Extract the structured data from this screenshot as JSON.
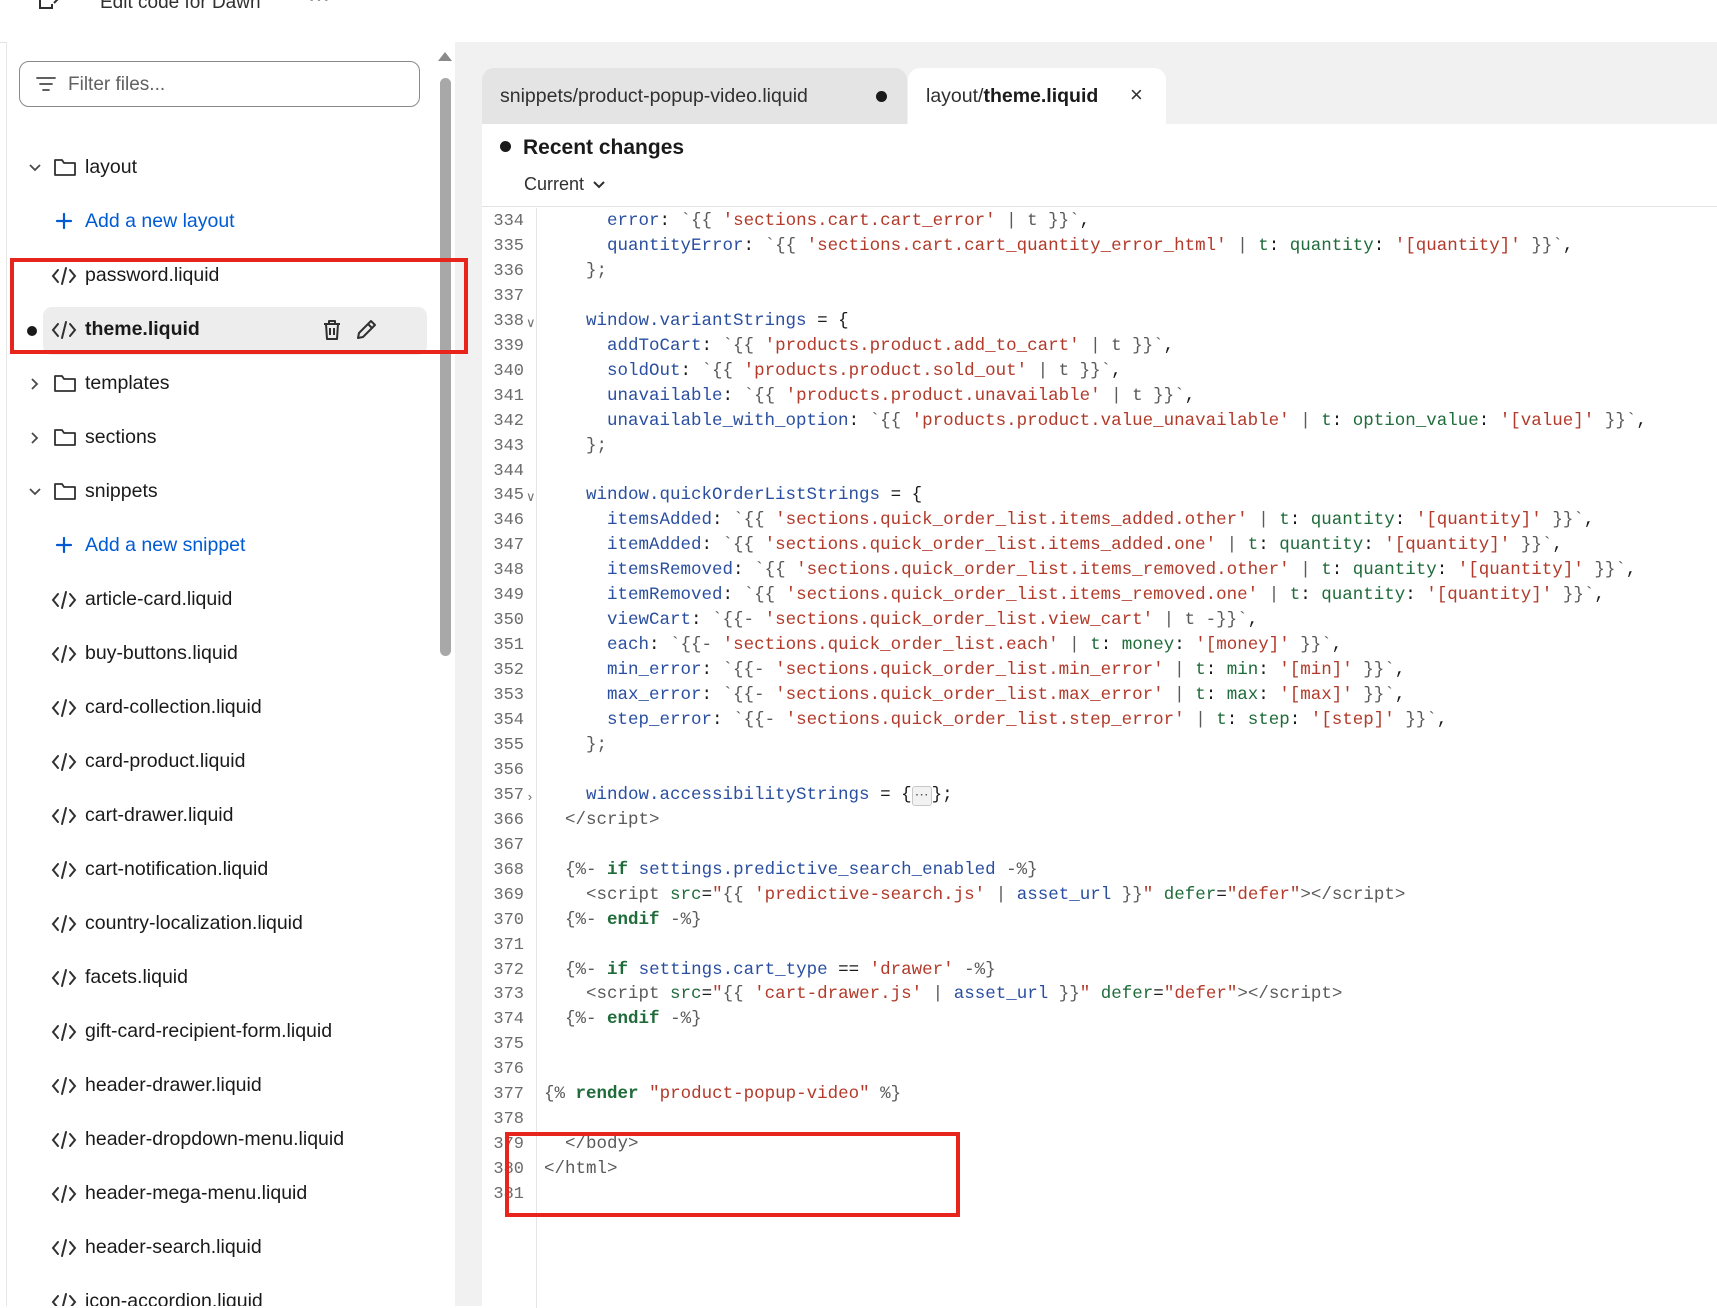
{
  "header": {
    "title": "Edit code for Dawn",
    "more_label": "⋯"
  },
  "sidebar": {
    "filter_placeholder": "Filter files...",
    "items": [
      {
        "type": "folder",
        "label": "layout",
        "expanded": true
      },
      {
        "type": "add",
        "label": "Add a new layout"
      },
      {
        "type": "file",
        "label": "password.liquid"
      },
      {
        "type": "file",
        "label": "theme.liquid",
        "selected": true,
        "modified": true
      },
      {
        "type": "folder",
        "label": "templates",
        "expanded": false
      },
      {
        "type": "folder",
        "label": "sections",
        "expanded": false
      },
      {
        "type": "folder",
        "label": "snippets",
        "expanded": true
      },
      {
        "type": "add",
        "label": "Add a new snippet"
      },
      {
        "type": "file",
        "label": "article-card.liquid"
      },
      {
        "type": "file",
        "label": "buy-buttons.liquid"
      },
      {
        "type": "file",
        "label": "card-collection.liquid"
      },
      {
        "type": "file",
        "label": "card-product.liquid"
      },
      {
        "type": "file",
        "label": "cart-drawer.liquid"
      },
      {
        "type": "file",
        "label": "cart-notification.liquid"
      },
      {
        "type": "file",
        "label": "country-localization.liquid"
      },
      {
        "type": "file",
        "label": "facets.liquid"
      },
      {
        "type": "file",
        "label": "gift-card-recipient-form.liquid"
      },
      {
        "type": "file",
        "label": "header-drawer.liquid"
      },
      {
        "type": "file",
        "label": "header-dropdown-menu.liquid"
      },
      {
        "type": "file",
        "label": "header-mega-menu.liquid"
      },
      {
        "type": "file",
        "label": "header-search.liquid"
      },
      {
        "type": "file",
        "label": "icon-accordion.liquid"
      }
    ]
  },
  "tabs": [
    {
      "label": "snippets/product-popup-video.liquid",
      "unsaved": true,
      "active": false
    },
    {
      "label_prefix": "layout/",
      "label_bold": "theme.liquid",
      "active": true
    }
  ],
  "editor": {
    "recent_changes": "Recent changes",
    "version_select": "Current",
    "accent_highlight": "#e8251d",
    "lines": [
      {
        "n": "334",
        "html": "      <span class='p'>error</span>: <span class='d'>`{{</span> <span class='s'>'sections.cart.cart_error'</span> <span class='d'>| t }}`</span>,"
      },
      {
        "n": "335",
        "html": "      <span class='p'>quantityError</span>: <span class='d'>`{{</span> <span class='s'>'sections.cart.cart_quantity_error_html'</span> <span class='d'>|</span> <span class='k'>t</span>: <span class='k'>quantity</span>: <span class='s'>'[quantity]'</span> <span class='d'>}}`</span>,"
      },
      {
        "n": "336",
        "html": "    <span class='d'>};</span>"
      },
      {
        "n": "337",
        "html": ""
      },
      {
        "n": "338",
        "fold": "v",
        "html": "    <span class='p'>window.variantStrings</span> = {"
      },
      {
        "n": "339",
        "html": "      <span class='p'>addToCart</span>: <span class='d'>`{{</span> <span class='s'>'products.product.add_to_cart'</span> <span class='d'>| t }}`</span>,"
      },
      {
        "n": "340",
        "html": "      <span class='p'>soldOut</span>: <span class='d'>`{{</span> <span class='s'>'products.product.sold_out'</span> <span class='d'>| t }}`</span>,"
      },
      {
        "n": "341",
        "html": "      <span class='p'>unavailable</span>: <span class='d'>`{{</span> <span class='s'>'products.product.unavailable'</span> <span class='d'>| t }}`</span>,"
      },
      {
        "n": "342",
        "html": "      <span class='p'>unavailable_with_option</span>: <span class='d'>`{{</span> <span class='s'>'products.product.value_unavailable'</span> <span class='d'>|</span> <span class='k'>t</span>: <span class='k'>option_value</span>: <span class='s'>'[value]'</span> <span class='d'>}}`</span>,"
      },
      {
        "n": "343",
        "html": "    <span class='d'>};</span>"
      },
      {
        "n": "344",
        "html": ""
      },
      {
        "n": "345",
        "fold": "v",
        "html": "    <span class='p'>window.quickOrderListStrings</span> = {"
      },
      {
        "n": "346",
        "html": "      <span class='p'>itemsAdded</span>: <span class='d'>`{{</span> <span class='s'>'sections.quick_order_list.items_added.other'</span> <span class='d'>|</span> <span class='k'>t</span>: <span class='k'>quantity</span>: <span class='s'>'[quantity]'</span> <span class='d'>}}`</span>,"
      },
      {
        "n": "347",
        "html": "      <span class='p'>itemAdded</span>: <span class='d'>`{{</span> <span class='s'>'sections.quick_order_list.items_added.one'</span> <span class='d'>|</span> <span class='k'>t</span>: <span class='k'>quantity</span>: <span class='s'>'[quantity]'</span> <span class='d'>}}`</span>,"
      },
      {
        "n": "348",
        "html": "      <span class='p'>itemsRemoved</span>: <span class='d'>`{{</span> <span class='s'>'sections.quick_order_list.items_removed.other'</span> <span class='d'>|</span> <span class='k'>t</span>: <span class='k'>quantity</span>: <span class='s'>'[quantity]'</span> <span class='d'>}}`</span>,"
      },
      {
        "n": "349",
        "html": "      <span class='p'>itemRemoved</span>: <span class='d'>`{{</span> <span class='s'>'sections.quick_order_list.items_removed.one'</span> <span class='d'>|</span> <span class='k'>t</span>: <span class='k'>quantity</span>: <span class='s'>'[quantity]'</span> <span class='d'>}}`</span>,"
      },
      {
        "n": "350",
        "html": "      <span class='p'>viewCart</span>: <span class='d'>`{{-</span> <span class='s'>'sections.quick_order_list.view_cart'</span> <span class='d'>| t -}}`</span>,"
      },
      {
        "n": "351",
        "html": "      <span class='p'>each</span>: <span class='d'>`{{-</span> <span class='s'>'sections.quick_order_list.each'</span> <span class='d'>|</span> <span class='k'>t</span>: <span class='k'>money</span>: <span class='s'>'[money]'</span> <span class='d'>}}`</span>,"
      },
      {
        "n": "352",
        "html": "      <span class='p'>min_error</span>: <span class='d'>`{{-</span> <span class='s'>'sections.quick_order_list.min_error'</span> <span class='d'>|</span> <span class='k'>t</span>: <span class='k'>min</span>: <span class='s'>'[min]'</span> <span class='d'>}}`</span>,"
      },
      {
        "n": "353",
        "html": "      <span class='p'>max_error</span>: <span class='d'>`{{-</span> <span class='s'>'sections.quick_order_list.max_error'</span> <span class='d'>|</span> <span class='k'>t</span>: <span class='k'>max</span>: <span class='s'>'[max]'</span> <span class='d'>}}`</span>,"
      },
      {
        "n": "354",
        "html": "      <span class='p'>step_error</span>: <span class='d'>`{{-</span> <span class='s'>'sections.quick_order_list.step_error'</span> <span class='d'>|</span> <span class='k'>t</span>: <span class='k'>step</span>: <span class='s'>'[step]'</span> <span class='d'>}}`</span>,"
      },
      {
        "n": "355",
        "html": "    <span class='d'>};</span>"
      },
      {
        "n": "356",
        "html": ""
      },
      {
        "n": "357",
        "fold": ">",
        "html": "    <span class='p'>window.accessibilityStrings</span> = {<span class='ell'>⋯</span>};"
      },
      {
        "n": "366",
        "html": "  <span class='d'>&lt;/script&gt;</span>"
      },
      {
        "n": "367",
        "html": ""
      },
      {
        "n": "368",
        "html": "  <span class='d'>{%-</span> <span class='kb'>if</span> <span class='p'>settings.predictive_search_enabled</span> <span class='d'>-%}</span>"
      },
      {
        "n": "369",
        "html": "    <span class='d'>&lt;script</span> <span class='k'>src</span>=<span class='s'>\"</span><span class='d'>{{</span> <span class='s'>'predictive-search.js'</span> <span class='d'>|</span> <span class='p'>asset_url</span> <span class='d'>}}</span><span class='s'>\"</span> <span class='k'>defer</span>=<span class='s'>\"defer\"</span><span class='d'>&gt;&lt;/script&gt;</span>"
      },
      {
        "n": "370",
        "html": "  <span class='d'>{%-</span> <span class='kb'>endif</span> <span class='d'>-%}</span>"
      },
      {
        "n": "371",
        "html": ""
      },
      {
        "n": "372",
        "html": "  <span class='d'>{%-</span> <span class='kb'>if</span> <span class='p'>settings.cart_type</span> == <span class='s'>'drawer'</span> <span class='d'>-%}</span>"
      },
      {
        "n": "373",
        "html": "    <span class='d'>&lt;script</span> <span class='k'>src</span>=<span class='s'>\"</span><span class='d'>{{</span> <span class='s'>'cart-drawer.js'</span> <span class='d'>|</span> <span class='p'>asset_url</span> <span class='d'>}}</span><span class='s'>\"</span> <span class='k'>defer</span>=<span class='s'>\"defer\"</span><span class='d'>&gt;&lt;/script&gt;</span>"
      },
      {
        "n": "374",
        "html": "  <span class='d'>{%-</span> <span class='kb'>endif</span> <span class='d'>-%}</span>"
      },
      {
        "n": "375",
        "html": ""
      },
      {
        "n": "376",
        "html": ""
      },
      {
        "n": "377",
        "html": "<span class='d'>{%</span> <span class='kb'>render</span> <span class='s'>\"product-popup-video\"</span> <span class='d'>%}</span>"
      },
      {
        "n": "378",
        "html": ""
      },
      {
        "n": "379",
        "html": "  <span class='d'>&lt;/body&gt;</span>"
      },
      {
        "n": "380",
        "html": "<span class='d'>&lt;/html&gt;</span>"
      },
      {
        "n": "381",
        "html": ""
      }
    ]
  }
}
